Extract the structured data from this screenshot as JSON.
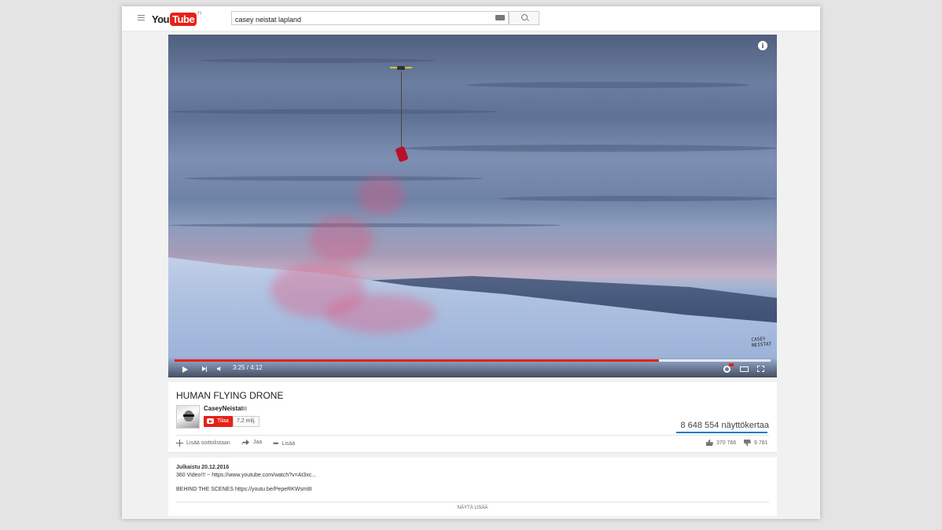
{
  "masthead": {
    "logo_you": "You",
    "logo_tube": "Tube",
    "logo_region": "FI",
    "search_value": "casey neistat lapland"
  },
  "player": {
    "time": "3:25 / 4:12",
    "progress_fraction": 0.813,
    "buffered_fraction": 1.0,
    "watermark": "CASEY NEISTAT",
    "info_icon_glyph": "i"
  },
  "video": {
    "title": "HUMAN FLYING DRONE",
    "channel": "CaseyNeistat",
    "subscribe_label": "Tilaa",
    "subscriber_count": "7,2 milj.",
    "views": "8 648 554 näyttökertaa",
    "actions": {
      "add_playlist": "Lisää soittolistaan",
      "share": "Jaa",
      "more": "Lisää",
      "more_glyph": "•••"
    },
    "likes": "370 766",
    "dislikes": "9 781"
  },
  "description": {
    "published": "Julkaistu 20.12.2016",
    "line1": "360 Video!!! ~ https://www.youtube.com/watch?v=At3xc...",
    "line2": "BEHIND THE SCENES https://youtu.be/PepeRKWsm8I",
    "show_more": "NÄYTÄ LISÄÄ"
  },
  "colors": {
    "brand_red": "#e62117",
    "view_bar_blue": "#167ac6"
  }
}
